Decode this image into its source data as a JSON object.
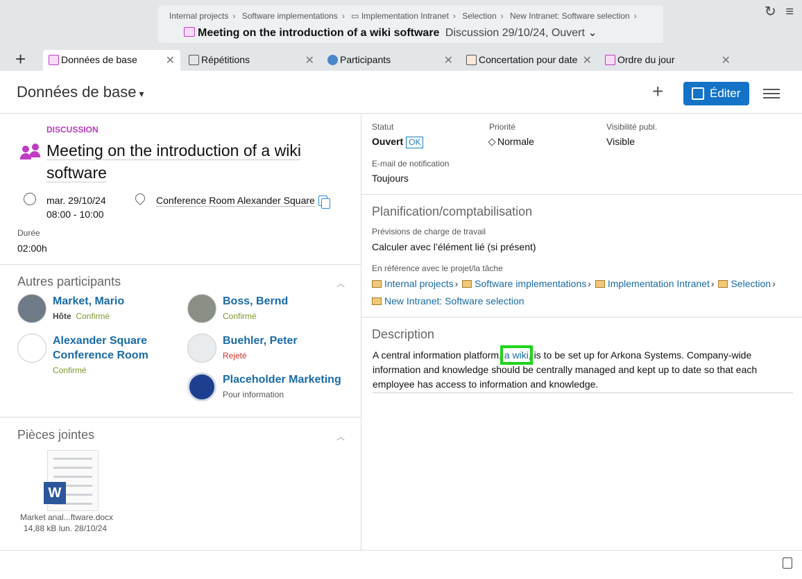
{
  "header": {
    "breadcrumbs": [
      "Internal projects",
      "Software implementations",
      "Implementation Intranet",
      "Selection",
      "New Intranet: Software selection"
    ],
    "title": "Meeting on the introduction of a wiki software",
    "subtitle": "Discussion 29/10/24, Ouvert"
  },
  "tabs": [
    {
      "label": "Données de base",
      "active": true,
      "icon": "calendar-icon"
    },
    {
      "label": "Répétitions",
      "active": false,
      "icon": "repeat-icon"
    },
    {
      "label": "Participants",
      "active": false,
      "icon": "participants-icon"
    },
    {
      "label": "Concertation pour date",
      "active": false,
      "icon": "calendar-check-icon"
    },
    {
      "label": "Ordre du jour",
      "active": false,
      "icon": "agenda-icon"
    }
  ],
  "page": {
    "title": "Données de base",
    "edit_label": "Éditer"
  },
  "details": {
    "kind": "DISCUSSION",
    "title": "Meeting on the introduction of a wiki software",
    "date": "mar. 29/10/24",
    "time": "08:00 - 10:00",
    "location": "Conference Room Alexander Square",
    "duration_label": "Durée",
    "duration": "02:00h"
  },
  "participants": {
    "title": "Autres participants",
    "items": [
      {
        "name": "Market, Mario",
        "role": "Hôte",
        "status": "Confirmé",
        "status_kind": "ok"
      },
      {
        "name": "Boss, Bernd",
        "role": "",
        "status": "Confirmé",
        "status_kind": "ok"
      },
      {
        "name": "Alexander Square Conference Room",
        "role": "",
        "status": "Confirmé",
        "status_kind": "ok"
      },
      {
        "name": "Buehler, Peter",
        "role": "",
        "status": "Rejeté",
        "status_kind": "no"
      },
      {
        "name": "Placeholder Marketing",
        "role": "",
        "status": "Pour information",
        "status_kind": "info"
      }
    ]
  },
  "attachments": {
    "title": "Pièces jointes",
    "files": [
      {
        "name": "Market anal...ftware.docx",
        "meta": "14,88 kB  lun. 28/10/24"
      }
    ]
  },
  "status": {
    "statut_label": "Statut",
    "statut": "Ouvert",
    "statut_badge": "OK",
    "priorite_label": "Priorité",
    "priorite": "Normale",
    "visibilite_label": "Visibilité publ.",
    "visibilite": "Visible",
    "email_label": "E-mail de notification",
    "email": "Toujours"
  },
  "planning": {
    "title": "Planification/comptabilisation",
    "workload_label": "Prévisions de charge de travail",
    "workload": "Calculer avec l’élément lié (si présent)",
    "ref_label": "En référence avec le projet/la tâche",
    "ref_path": [
      "Internal projects",
      "Software implementations",
      "Implementation Intranet",
      "Selection"
    ],
    "ref_last": "New Intranet: Software selection"
  },
  "description": {
    "title": "Description",
    "before": "A central information platform, ",
    "link": "a wiki",
    "after": ", is to be set up for Arkona Systems. Company-wide information and knowledge should be centrally managed and kept up to date so that each employee has access to information and knowledge."
  }
}
